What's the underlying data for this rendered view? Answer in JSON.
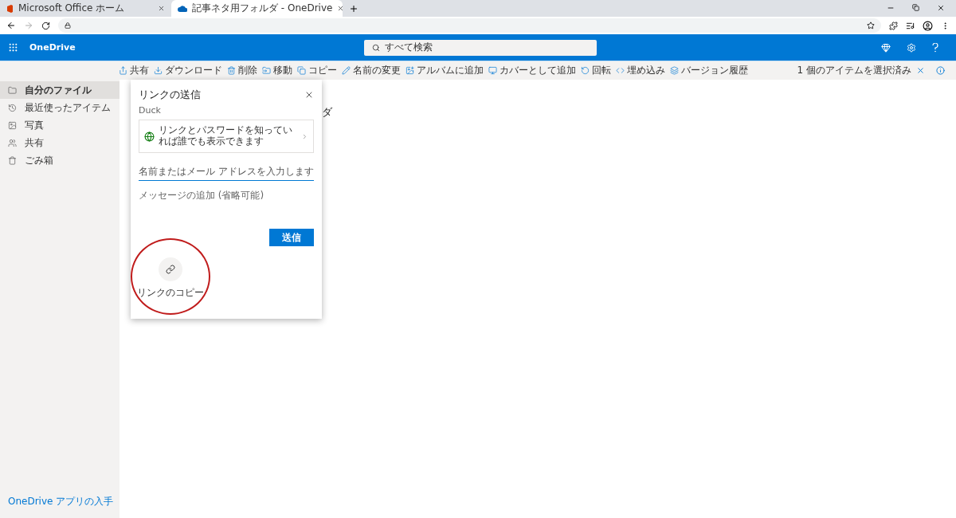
{
  "browser": {
    "tabs": [
      {
        "title": "Microsoft Office ホーム",
        "selected": false
      },
      {
        "title": "記事ネタ用フォルダ - OneDrive",
        "selected": true
      }
    ]
  },
  "header": {
    "app_name": "OneDrive",
    "search_placeholder": "すべて検索"
  },
  "commands": [
    {
      "label": "共有"
    },
    {
      "label": "ダウンロード"
    },
    {
      "label": "削除"
    },
    {
      "label": "移動"
    },
    {
      "label": "コピー"
    },
    {
      "label": "名前の変更"
    },
    {
      "label": "アルバムに追加"
    },
    {
      "label": "カバーとして追加"
    },
    {
      "label": "回転"
    },
    {
      "label": "埋め込み"
    },
    {
      "label": "バージョン履歴"
    }
  ],
  "selection": "1 個のアイテムを選択済み",
  "sidebar": {
    "items": [
      {
        "label": "自分のファイル",
        "selected": true
      },
      {
        "label": "最近使ったアイテム",
        "selected": false
      },
      {
        "label": "写真",
        "selected": false
      },
      {
        "label": "共有",
        "selected": false
      },
      {
        "label": "ごみ箱",
        "selected": false
      }
    ],
    "footer_link": "OneDrive アプリの入手"
  },
  "folder_title_visible": "ダ",
  "dialog": {
    "title": "リンクの送信",
    "owner": "Duck",
    "permission": "リンクとパスワードを知っていれば誰でも表示できます",
    "to_placeholder": "名前またはメール アドレスを入力します",
    "message_placeholder": "メッセージの追加 (省略可能)",
    "send_button": "送信",
    "copy_link": "リンクのコピー",
    "copy_link_circled": true
  }
}
